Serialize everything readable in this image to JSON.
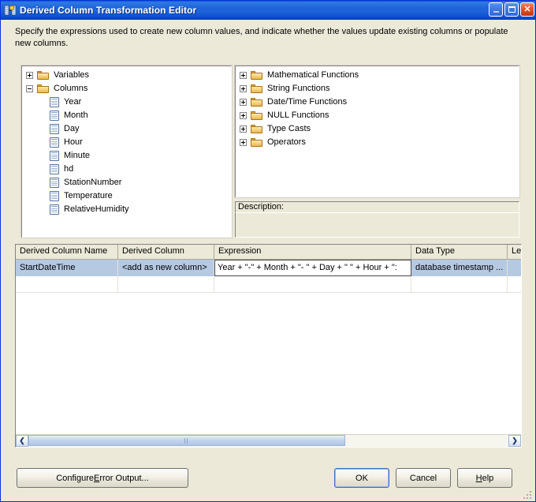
{
  "window": {
    "title": "Derived Column Transformation Editor",
    "icon": "derived-column-icon",
    "controls": {
      "minimize": "–",
      "maximize": "□",
      "close": "✕"
    }
  },
  "instructions": "Specify the expressions used to create new column values, and indicate whether the values update existing columns or populate new columns.",
  "left_tree": {
    "nodes": [
      {
        "label": "Variables",
        "type": "folder",
        "state": "collapsed",
        "expander": "plus"
      },
      {
        "label": "Columns",
        "type": "folder",
        "state": "expanded",
        "expander": "minus"
      }
    ],
    "columns": [
      {
        "label": "Year"
      },
      {
        "label": "Month"
      },
      {
        "label": "Day"
      },
      {
        "label": "Hour"
      },
      {
        "label": "Minute"
      },
      {
        "label": "hd"
      },
      {
        "label": "StationNumber"
      },
      {
        "label": "Temperature"
      },
      {
        "label": "RelativeHumidity"
      }
    ]
  },
  "right_tree": {
    "nodes": [
      {
        "label": "Mathematical Functions",
        "state": "collapsed"
      },
      {
        "label": "String Functions",
        "state": "collapsed"
      },
      {
        "label": "Date/Time Functions",
        "state": "collapsed"
      },
      {
        "label": "NULL Functions",
        "state": "collapsed"
      },
      {
        "label": "Type Casts",
        "state": "collapsed"
      },
      {
        "label": "Operators",
        "state": "collapsed"
      }
    ]
  },
  "description": {
    "label": "Description:",
    "text": ""
  },
  "grid": {
    "headers": [
      "Derived Column Name",
      "Derived Column",
      "Expression",
      "Data Type",
      "Le"
    ],
    "rows": [
      {
        "derived_column_name": "StartDateTime",
        "derived_column": "<add as new column>",
        "expression": "Year + \"-\" + Month + \"- \" + Day + \" \" + Hour + \":",
        "data_type": "database timestamp ...",
        "length": "",
        "selected": true
      },
      {
        "derived_column_name": "",
        "derived_column": "",
        "expression": "",
        "data_type": "",
        "length": "",
        "selected": false
      }
    ]
  },
  "scrollbar": {
    "left_arrow": "❮",
    "right_arrow": "❯"
  },
  "buttons": {
    "configure_error_output": {
      "before": "Configure ",
      "accel": "E",
      "after": "rror Output..."
    },
    "ok": "OK",
    "cancel": "Cancel",
    "help": {
      "before": "",
      "accel": "H",
      "after": "elp"
    }
  },
  "colors": {
    "titlebar_blue": "#1e63d9",
    "dialog_face": "#ece9d8",
    "selection_blue": "#b6c9e3",
    "close_red": "#c23415"
  }
}
